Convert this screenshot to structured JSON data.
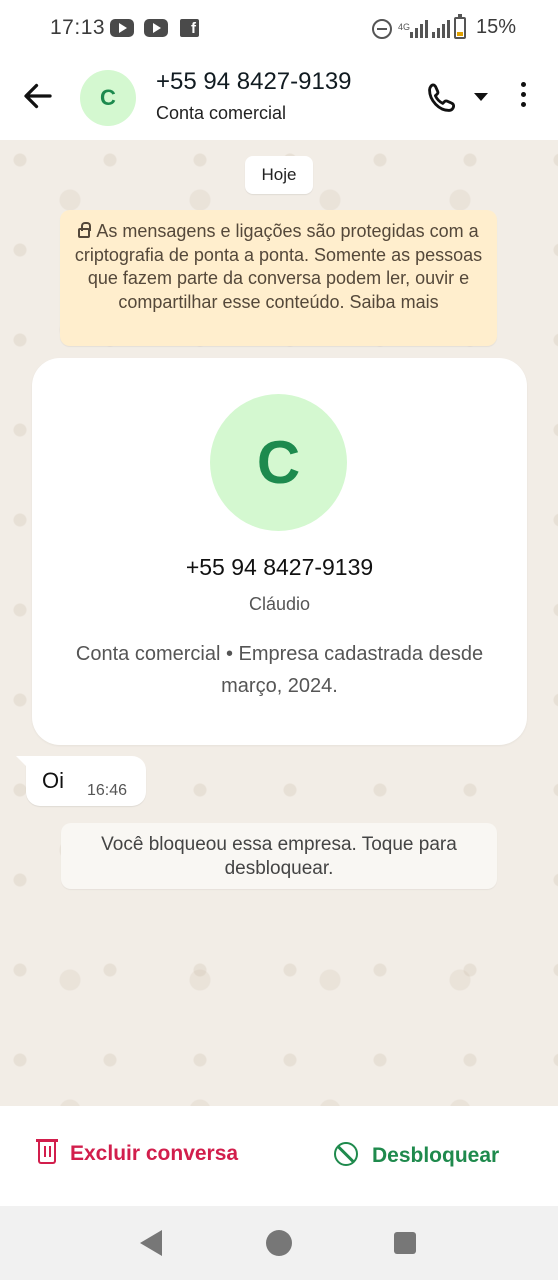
{
  "status_bar": {
    "time": "17:13",
    "battery": "15%",
    "network": "4G",
    "icons": [
      "youtube-icon",
      "youtube-icon",
      "facebook-icon",
      "dnd-icon",
      "signal-icon",
      "battery-icon"
    ]
  },
  "header": {
    "contact_initial": "C",
    "title": "+55 94 8427-9139",
    "subtitle": "Conta comercial"
  },
  "chat": {
    "date_label": "Hoje",
    "encryption_notice": "As mensagens e ligações são protegidas com a criptografia de ponta a ponta. Somente as pessoas que fazem parte da conversa podem ler, ouvir e compartilhar esse conteúdo. Saiba mais",
    "profile_card": {
      "initial": "C",
      "phone": "+55 94 8427-9139",
      "name": "Cláudio",
      "description": "Conta comercial • Empresa cadastrada desde março, 2024."
    },
    "messages": [
      {
        "text": "Oi",
        "time": "16:46",
        "direction": "incoming"
      }
    ],
    "blocked_notice": "Você bloqueou essa empresa. Toque para desbloquear."
  },
  "actions": {
    "delete_label": "Excluir conversa",
    "unblock_label": "Desbloquear"
  },
  "colors": {
    "accent_green": "#1f8a4d",
    "danger_red": "#d21e4c",
    "chat_bg": "#f2ede6",
    "notice_bg": "#ffeecd",
    "avatar_bg": "#d4f8d0"
  }
}
